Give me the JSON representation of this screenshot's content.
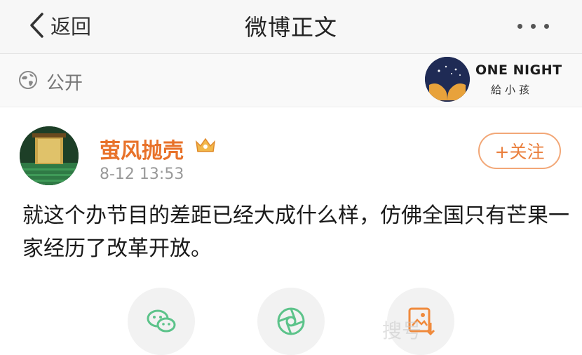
{
  "nav": {
    "back_label": "返回",
    "title": "微博正文",
    "more_icon": "more-dots-icon"
  },
  "visibility": {
    "icon": "globe-icon",
    "label": "公开"
  },
  "ad_logo": {
    "main": "ONE NIGHT",
    "sub": "給小孩"
  },
  "post": {
    "username": "萤风抛壳",
    "badge_icon": "vip-crown-icon",
    "timestamp": "8-12 13:53",
    "follow_label": "+关注",
    "text": "就这个办节目的差距已经大成什么样，仿佛全国只有芒果一家经历了改革开放。"
  },
  "share": [
    {
      "icon": "wechat-icon"
    },
    {
      "icon": "moments-icon"
    },
    {
      "icon": "save-image-icon"
    }
  ],
  "watermark": "搜号",
  "colors": {
    "accent": "#e8722a",
    "follow_border": "#f2a777",
    "share_green": "#5cc38a",
    "share_orange": "#f08a3c"
  }
}
